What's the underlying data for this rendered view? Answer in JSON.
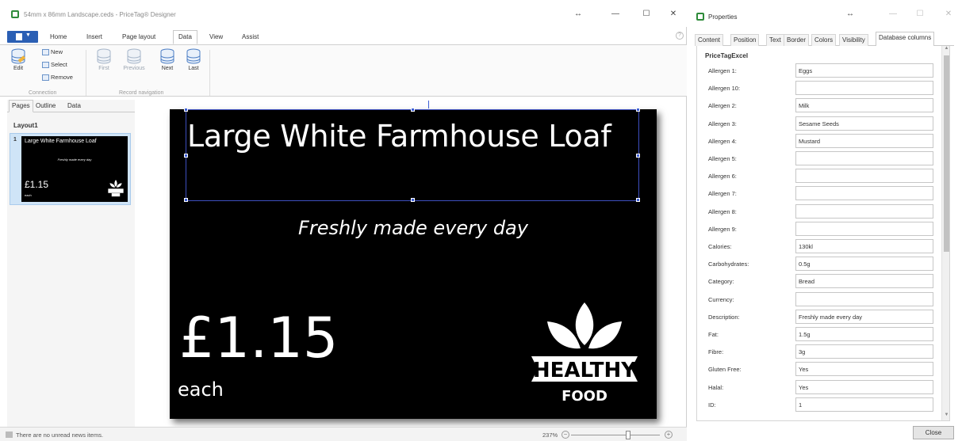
{
  "main_window": {
    "title": "54mm x 86mm Landscape.ceds - PriceTag® Designer",
    "controls": {
      "restore": "↔",
      "minimize": "—",
      "maximize": "☐",
      "close": "✕"
    }
  },
  "ribbon": {
    "tabs": [
      "Home",
      "Insert",
      "Page layout",
      "Data",
      "View",
      "Assist"
    ],
    "active_tab": "Data",
    "help": "?",
    "connection": {
      "edit_label": "Edit",
      "new_label": "New",
      "select_label": "Select",
      "remove_label": "Remove",
      "group_label": "Connection"
    },
    "record_navigation": {
      "first_label": "First",
      "previous_label": "Previous",
      "next_label": "Next",
      "last_label": "Last",
      "group_label": "Record navigation"
    }
  },
  "left_pane": {
    "tabs": [
      "Pages",
      "Outline",
      "Data"
    ],
    "active_tab": "Pages",
    "layout_name": "Layout1",
    "thumbnail": {
      "number": "1",
      "title": "Large White Farmhouse Loaf",
      "subtitle": "Freshly made every day",
      "price": "£1.15",
      "each": "each"
    }
  },
  "label": {
    "title": "Large White Farmhouse Loaf",
    "subtitle": "Freshly made every day",
    "price": "£1.15",
    "unit": "each",
    "logo_text_main": "HEALTHY",
    "logo_text_sub": "FOOD"
  },
  "statusbar": {
    "message": "There are no unread news items.",
    "zoom": "237%",
    "zoom_fraction": 0.64
  },
  "properties": {
    "title": "Properties",
    "controls": {
      "restore": "↔",
      "minimize": "—",
      "maximize": "☐",
      "close": "✕"
    },
    "tabs": [
      "Content",
      "Position",
      "Text",
      "Border",
      "Colors",
      "Visibility",
      "Database columns"
    ],
    "active_tab": "Database columns",
    "section": "PriceTagExcel",
    "rows": [
      {
        "label": "Allergen 1:",
        "value": "Eggs"
      },
      {
        "label": "Allergen 10:",
        "value": ""
      },
      {
        "label": "Allergen 2:",
        "value": "Milk"
      },
      {
        "label": "Allergen 3:",
        "value": "Sesame Seeds"
      },
      {
        "label": "Allergen 4:",
        "value": "Mustard"
      },
      {
        "label": "Allergen 5:",
        "value": ""
      },
      {
        "label": "Allergen 6:",
        "value": ""
      },
      {
        "label": "Allergen 7:",
        "value": ""
      },
      {
        "label": "Allergen 8:",
        "value": ""
      },
      {
        "label": "Allergen 9:",
        "value": ""
      },
      {
        "label": "Calories:",
        "value": "130kl"
      },
      {
        "label": "Carbohydrates:",
        "value": "0.5g"
      },
      {
        "label": "Category:",
        "value": "Bread"
      },
      {
        "label": "Currency:",
        "value": ""
      },
      {
        "label": "Description:",
        "value": "Freshly made every day"
      },
      {
        "label": "Fat:",
        "value": "1.5g"
      },
      {
        "label": "Fibre:",
        "value": "3g"
      },
      {
        "label": "Gluten Free:",
        "value": "Yes"
      },
      {
        "label": "Halal:",
        "value": "Yes"
      },
      {
        "label": "ID:",
        "value": "1"
      }
    ],
    "close_label": "Close"
  },
  "colors": {
    "accent_blue": "#2b5fb4",
    "selection": "#3d4fbf",
    "app_green": "#2e8b3a",
    "label_bg": "#000000"
  }
}
